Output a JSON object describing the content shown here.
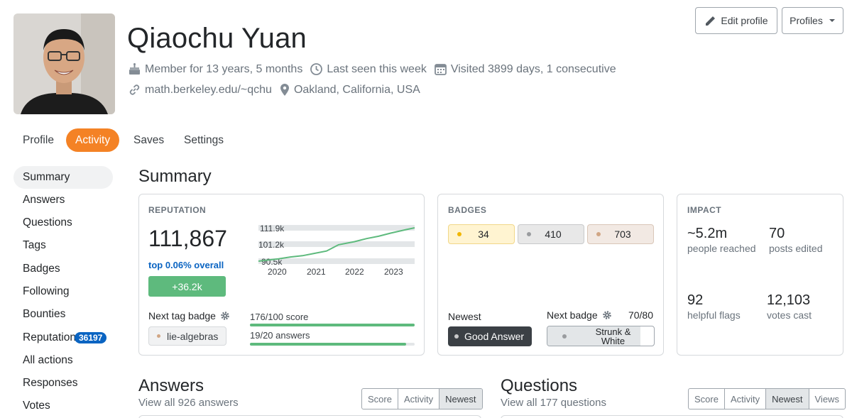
{
  "user": {
    "name": "Qiaochu Yuan",
    "member_for": "Member for 13 years, 5 months",
    "last_seen": "Last seen this week",
    "visited": "Visited 3899 days, 1 consecutive",
    "website": "math.berkeley.edu/~qchu",
    "location": "Oakland, California, USA"
  },
  "header_buttons": {
    "edit_profile": "Edit profile",
    "profiles": "Profiles"
  },
  "top_tabs": [
    {
      "label": "Profile",
      "active": false
    },
    {
      "label": "Activity",
      "active": true
    },
    {
      "label": "Saves",
      "active": false
    },
    {
      "label": "Settings",
      "active": false
    }
  ],
  "sidebar": {
    "items": [
      {
        "label": "Summary",
        "active": true
      },
      {
        "label": "Answers"
      },
      {
        "label": "Questions"
      },
      {
        "label": "Tags"
      },
      {
        "label": "Badges"
      },
      {
        "label": "Following"
      },
      {
        "label": "Bounties"
      },
      {
        "label": "Reputation",
        "count": "36197"
      },
      {
        "label": "All actions"
      },
      {
        "label": "Responses"
      },
      {
        "label": "Votes"
      }
    ]
  },
  "summary": {
    "title": "Summary",
    "reputation": {
      "label": "REPUTATION",
      "value": "111,867",
      "rank": "top 0.06% overall",
      "change": "+36.2k",
      "chart": {
        "y_ticks": [
          "111.9k",
          "101.2k",
          "90.5k"
        ],
        "x_ticks": [
          "2020",
          "2021",
          "2022",
          "2023"
        ]
      },
      "next_tag_badge_label": "Next tag badge",
      "tag": "lie-algebras",
      "score_progress": "176/100 score",
      "answers_progress": "19/20 answers",
      "score_fraction": 1.0,
      "answers_fraction": 0.95
    },
    "badges": {
      "label": "BADGES",
      "gold": "34",
      "silver": "410",
      "bronze": "703",
      "newest_label": "Newest",
      "newest_badge": "Good Answer",
      "next_badge_label": "Next badge",
      "next_badge_progress": "70/80",
      "next_badge_name_line1": "Strunk &",
      "next_badge_name_line2": "White",
      "next_badge_fraction": 0.875
    },
    "impact": {
      "label": "IMPACT",
      "stats": [
        {
          "value": "~5.2m",
          "label": "people reached"
        },
        {
          "value": "70",
          "label": "posts edited"
        },
        {
          "value": "92",
          "label": "helpful flags"
        },
        {
          "value": "12,103",
          "label": "votes cast"
        }
      ]
    }
  },
  "answers_section": {
    "title": "Answers",
    "link": "View all 926 answers",
    "sorts": [
      "Score",
      "Activity",
      "Newest"
    ],
    "selected": "Newest"
  },
  "questions_section": {
    "title": "Questions",
    "link": "View all 177 questions",
    "sorts": [
      "Score",
      "Activity",
      "Newest",
      "Views"
    ],
    "selected": "Newest"
  },
  "chart_data": {
    "type": "line",
    "x": [
      2019.8,
      2020.3,
      2020.6,
      2020.9,
      2021.2,
      2021.5,
      2021.8,
      2022.2,
      2022.5,
      2022.8,
      2023.1,
      2023.5,
      2023.7
    ],
    "y": [
      90.5,
      92.0,
      93.2,
      94.0,
      95.5,
      97.0,
      101.0,
      103.0,
      105.0,
      106.5,
      108.5,
      110.8,
      111.9
    ],
    "xlabel": "",
    "ylabel": "",
    "y_ticks": [
      90.5,
      101.2,
      111.9
    ],
    "x_ticks": [
      2020,
      2021,
      2022,
      2023
    ],
    "xlim": [
      2019.8,
      2023.7
    ],
    "ylim": [
      90.5,
      111.9
    ]
  },
  "colors": {
    "accent": "#f48225",
    "green": "#5eba7d",
    "blue": "#0a64c2",
    "gold_bg": "#fff4d1",
    "gold_dot": "#f1b600",
    "silver_bg": "#e8e8e8",
    "silver_dot": "#9a9c9f",
    "bronze_bg": "#f2e9e3",
    "bronze_dot": "#d1a684"
  }
}
